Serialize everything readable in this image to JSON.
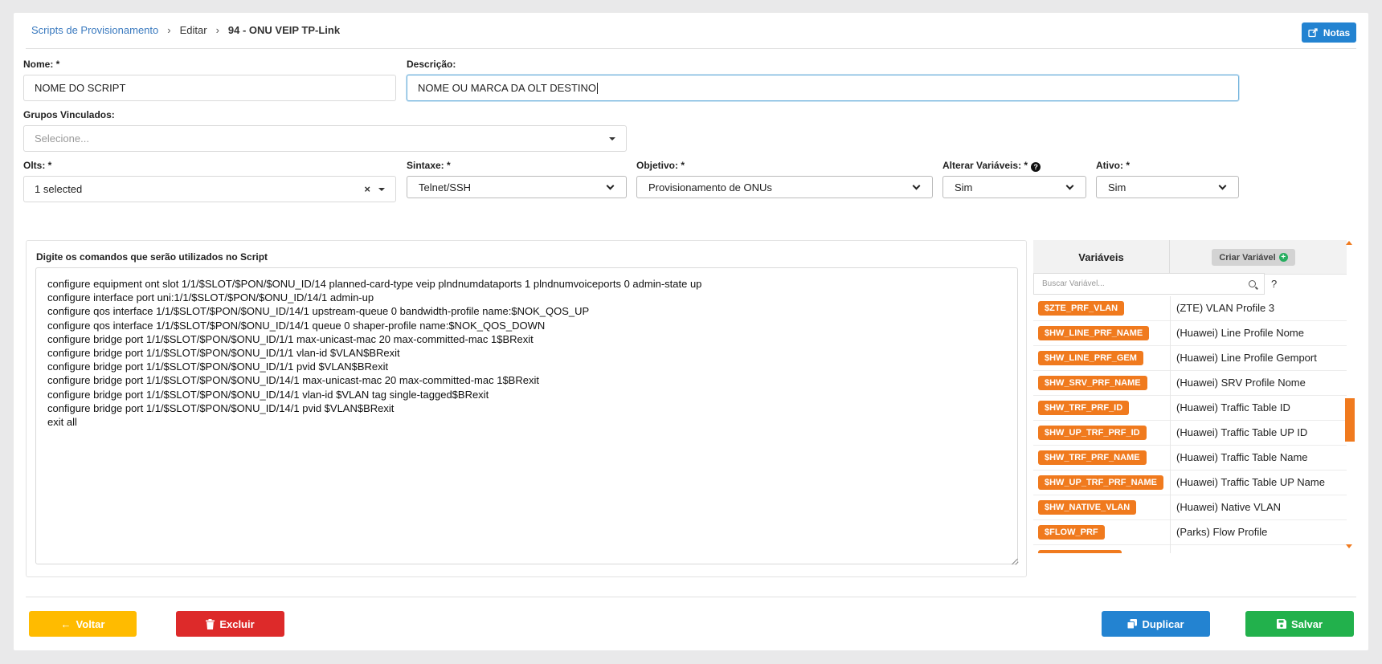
{
  "breadcrumb": {
    "root": "Scripts de Provisionamento",
    "edit": "Editar",
    "current": "94 - ONU VEIP TP-Link"
  },
  "header": {
    "notes_label": "Notas"
  },
  "form": {
    "name_label": "Nome: *",
    "name_value": "NOME DO SCRIPT",
    "description_label": "Descrição:",
    "description_value": "NOME OU MARCA DA OLT DESTINO",
    "groups_label": "Grupos Vinculados:",
    "groups_placeholder": "Selecione...",
    "olts_label": "Olts: *",
    "olts_value": "1 selected",
    "syntax_label": "Sintaxe: *",
    "syntax_value": "Telnet/SSH",
    "objective_label": "Objetivo: *",
    "objective_value": "Provisionamento de ONUs",
    "change_vars_label": "Alterar Variáveis: *",
    "change_vars_value": "Sim",
    "active_label": "Ativo: *",
    "active_value": "Sim"
  },
  "script": {
    "title": "Digite os comandos que serão utilizados no Script",
    "commands": "configure equipment ont slot 1/1/$SLOT/$PON/$ONU_ID/14 planned-card-type veip plndnumdataports 1 plndnumvoiceports 0 admin-state up\nconfigure interface port uni:1/1/$SLOT/$PON/$ONU_ID/14/1 admin-up\nconfigure qos interface 1/1/$SLOT/$PON/$ONU_ID/14/1 upstream-queue 0 bandwidth-profile name:$NOK_QOS_UP\nconfigure qos interface 1/1/$SLOT/$PON/$ONU_ID/14/1 queue 0 shaper-profile name:$NOK_QOS_DOWN\nconfigure bridge port 1/1/$SLOT/$PON/$ONU_ID/1/1 max-unicast-mac 20 max-committed-mac 1$BRexit\nconfigure bridge port 1/1/$SLOT/$PON/$ONU_ID/1/1 vlan-id $VLAN$BRexit\nconfigure bridge port 1/1/$SLOT/$PON/$ONU_ID/1/1 pvid $VLAN$BRexit\nconfigure bridge port 1/1/$SLOT/$PON/$ONU_ID/14/1 max-unicast-mac 20 max-committed-mac 1$BRexit\nconfigure bridge port 1/1/$SLOT/$PON/$ONU_ID/14/1 vlan-id $VLAN tag single-tagged$BRexit\nconfigure bridge port 1/1/$SLOT/$PON/$ONU_ID/14/1 pvid $VLAN$BRexit\nexit all"
  },
  "variables": {
    "header": "Variáveis",
    "create_label": "Criar Variável",
    "search_placeholder": "Buscar Variável...",
    "hidden_char": "?",
    "rows": [
      {
        "name": "$ZTE_PRF_VLAN",
        "desc": "(ZTE) VLAN Profile 3"
      },
      {
        "name": "$HW_LINE_PRF_NAME",
        "desc": "(Huawei) Line Profile Nome"
      },
      {
        "name": "$HW_LINE_PRF_GEM",
        "desc": "(Huawei) Line Profile Gemport"
      },
      {
        "name": "$HW_SRV_PRF_NAME",
        "desc": "(Huawei) SRV Profile Nome"
      },
      {
        "name": "$HW_TRF_PRF_ID",
        "desc": "(Huawei) Traffic Table ID"
      },
      {
        "name": "$HW_UP_TRF_PRF_ID",
        "desc": "(Huawei) Traffic Table UP ID"
      },
      {
        "name": "$HW_TRF_PRF_NAME",
        "desc": "(Huawei) Traffic Table Name"
      },
      {
        "name": "$HW_UP_TRF_PRF_NAME",
        "desc": "(Huawei) Traffic Table UP Name"
      },
      {
        "name": "$HW_NATIVE_VLAN",
        "desc": "(Huawei) Native VLAN"
      },
      {
        "name": "$FLOW_PRF",
        "desc": "(Parks) Flow Profile"
      }
    ]
  },
  "footer": {
    "back_label": "Voltar",
    "delete_label": "Excluir",
    "duplicate_label": "Duplicar",
    "save_label": "Salvar"
  },
  "colors": {
    "primary": "#2383d1",
    "warning": "#ffbb00",
    "danger": "#dd2a2a",
    "success": "#22b14c",
    "variable_badge": "#f07a1e"
  }
}
